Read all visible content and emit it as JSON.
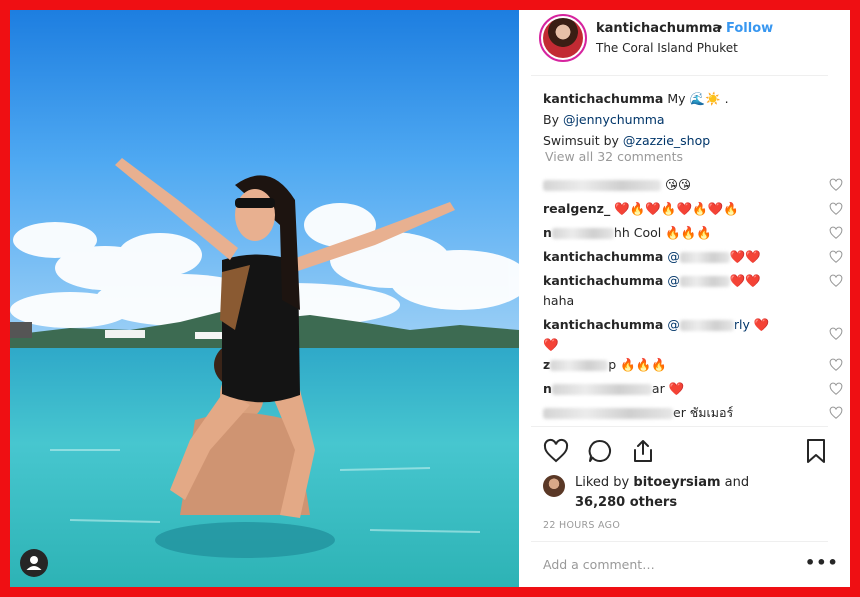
{
  "header": {
    "username": "kantichachumma",
    "dot": "•",
    "follow_label": "Follow",
    "location": "The Coral Island Phuket",
    "avatar_icon": "profile-avatar"
  },
  "caption": {
    "username": "kantichachumma",
    "text_part1": "My",
    "emoji_wave": "🌊",
    "emoji_sun": "☀️",
    "text_end": ".",
    "line2_prefix": "By ",
    "line2_mention": "@jennychumma",
    "line3_prefix": "Swimsuit by ",
    "line3_mention": "@zazzie_shop"
  },
  "view_all_comments": "View all 32 comments",
  "comments": [
    {
      "user_visible": "",
      "text": "😘😘"
    },
    {
      "user_visible": "realgenz_",
      "text": "❤️🔥❤️🔥❤️🔥❤️🔥"
    },
    {
      "user_visible": "n",
      "text": "hh Cool 🔥🔥🔥"
    },
    {
      "user_visible": "kantichachumma",
      "mention_visible": "@",
      "text": "❤️❤️"
    },
    {
      "user_visible": "kantichachumma",
      "mention_visible": "@",
      "text": "❤️❤️",
      "line2": "haha"
    },
    {
      "user_visible": "kantichachumma",
      "mention_visible": "@",
      "mention_tail": "rly",
      "text": "❤️",
      "line2": "❤️"
    },
    {
      "user_visible": "z",
      "text": "p 🔥🔥🔥"
    },
    {
      "user_visible": "n",
      "text": "ar ❤️"
    },
    {
      "user_visible": "",
      "text": "er ชัมเมอร์"
    }
  ],
  "liked_by": {
    "prefix": "Liked by ",
    "user": "bitoeyrsiam",
    "suffix": " and",
    "count": "36,280 others"
  },
  "timestamp": "22 HOURS AGO",
  "add_comment_placeholder": "Add a comment…",
  "more_label": "•••",
  "colors": {
    "frame": "#ef0f13",
    "link_blue": "#3897f0",
    "mention": "#003569",
    "muted": "#999999"
  }
}
